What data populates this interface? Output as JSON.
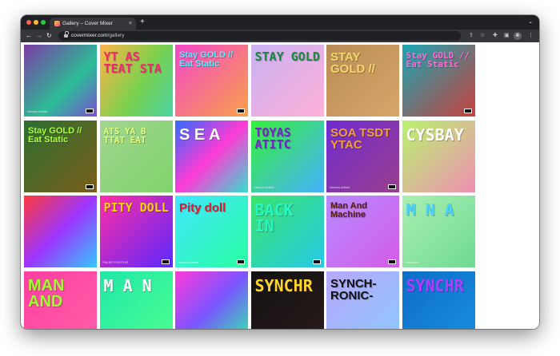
{
  "browser": {
    "tab": {
      "title": "Gallery – Cover Mixer",
      "close": "×"
    },
    "new_tab": "+",
    "tab_menu": "⌄",
    "back": "←",
    "forward": "→",
    "reload": "↻",
    "url_domain": "covermixer.com",
    "url_path": "/gallery",
    "toolbar_icons": [
      "share-icon",
      "star-icon",
      "extensions-icon",
      "sidepanel-icon",
      "profile-avatar",
      "menu-icon"
    ],
    "profile_initials": "R"
  },
  "gallery": {
    "covers": [
      {
        "title": "",
        "artist": "Various Artists",
        "bg": "linear-gradient(135deg,#7d3aa6,#2bbd97 60%,#7b4fd1)",
        "text_color": "#ff4fcf",
        "explicit": true
      },
      {
        "title": "YT AS TEAT STA",
        "artist": "",
        "bg": "linear-gradient(120deg,#ffb347,#7ad14e 55%,#4bd3a3)",
        "text_color": "#f02b6f",
        "explicit": false
      },
      {
        "title": "Stay GOLD // Eat Static",
        "artist": "",
        "bg": "linear-gradient(135deg,#f347c8,#f9a14a)",
        "text_color": "#4df0ff",
        "explicit": true
      },
      {
        "title": "STAY GOLD",
        "artist": "",
        "bg": "linear-gradient(135deg,#c9b2f2,#ffb0d9)",
        "text_color": "#1a8a43",
        "explicit": false
      },
      {
        "title": "STAY GOLD //",
        "artist": "",
        "bg": "linear-gradient(135deg,#b88c55,#d9a66b)",
        "text_color": "#f5d66a",
        "explicit": false
      },
      {
        "title": "Stay GOLD // Eat Static",
        "artist": "",
        "bg": "linear-gradient(135deg,#1aa6b5,#c7413b)",
        "text_color": "#ff6ad8",
        "explicit": true
      },
      {
        "title": "Stay GOLD // Eat Static",
        "artist": "",
        "bg": "linear-gradient(135deg,#2c6e2f,#7a5e1b)",
        "text_color": "#a8ff3d",
        "explicit": true
      },
      {
        "title": "ATS YA B TTAT EAT",
        "artist": "",
        "bg": "linear-gradient(135deg,#a2d58f,#7ed46c)",
        "text_color": "#e6ff7a",
        "explicit": false
      },
      {
        "title": "S E A",
        "artist": "",
        "bg": "linear-gradient(135deg,#2d6bff,#ff3bd5 50%,#36e0d0)",
        "text_color": "#ffffff",
        "explicit": false
      },
      {
        "title": "TOYAS ATITC",
        "artist": "Various Artists",
        "bg": "linear-gradient(135deg,#36f038,#46b0ff)",
        "text_color": "#7b1fd1",
        "explicit": false
      },
      {
        "title": "SOA TSDT YTAC",
        "artist": "Various Artists",
        "bg": "linear-gradient(135deg,#6f2bd1,#9a3f8c)",
        "text_color": "#f3a02c",
        "explicit": true
      },
      {
        "title": "CYSBAY",
        "artist": "",
        "bg": "linear-gradient(135deg,#b8f36e,#f08fb2)",
        "text_color": "#ffffff",
        "explicit": false
      },
      {
        "title": "",
        "artist": "",
        "bg": "linear-gradient(135deg,#ff3b3b,#9b35ff 50%,#35c8ff)",
        "text_color": "#ffffff",
        "explicit": false
      },
      {
        "title": "PITY DOLL",
        "artist": "FALSE POSITIVE",
        "bg": "linear-gradient(135deg,#ff2da5,#5a28ff)",
        "text_color": "#ffd400",
        "explicit": true
      },
      {
        "title": "Pity doll",
        "artist": "Various Artists",
        "bg": "linear-gradient(135deg,#43e6ff,#28ffa0)",
        "text_color": "#e3162f",
        "explicit": true
      },
      {
        "title": "BACK IN",
        "artist": "",
        "bg": "linear-gradient(135deg,#3de36c,#25c9e8)",
        "text_color": "#27f7c0",
        "explicit": true
      },
      {
        "title": "Man And Machine",
        "artist": "",
        "bg": "linear-gradient(135deg,#b78aff,#d45ce8)",
        "text_color": "#5a1b12",
        "explicit": true
      },
      {
        "title": "M N A",
        "artist": "Kraftwerk",
        "bg": "linear-gradient(135deg,#a9f0b1,#6fd994)",
        "text_color": "#4ad1ff",
        "explicit": false
      },
      {
        "title": "MAN AND",
        "artist": "",
        "bg": "linear-gradient(135deg,#ff3fa1,#ff5fa8)",
        "text_color": "#9bff2f",
        "explicit": false
      },
      {
        "title": "M A N",
        "artist": "",
        "bg": "linear-gradient(135deg,#1fe7a8,#4dff8f)",
        "text_color": "#ffffff",
        "explicit": false
      },
      {
        "title": "",
        "artist": "",
        "bg": "linear-gradient(135deg,#ff3ad9,#7a55ff 50%,#31f0a9)",
        "text_color": "#ffffff",
        "explicit": false
      },
      {
        "title": "SYNCHR",
        "artist": "",
        "bg": "linear-gradient(135deg,#111111,#2a1b1b)",
        "text_color": "#ffd52c",
        "explicit": false
      },
      {
        "title": "SYNCH- RONIC-",
        "artist": "",
        "bg": "linear-gradient(135deg,#b7a8ff,#8dc7ff)",
        "text_color": "#111111",
        "explicit": false
      },
      {
        "title": "SYNCHR",
        "artist": "",
        "bg": "linear-gradient(135deg,#0b6ec7,#1b8de0)",
        "text_color": "#b13cff",
        "explicit": false
      }
    ]
  }
}
